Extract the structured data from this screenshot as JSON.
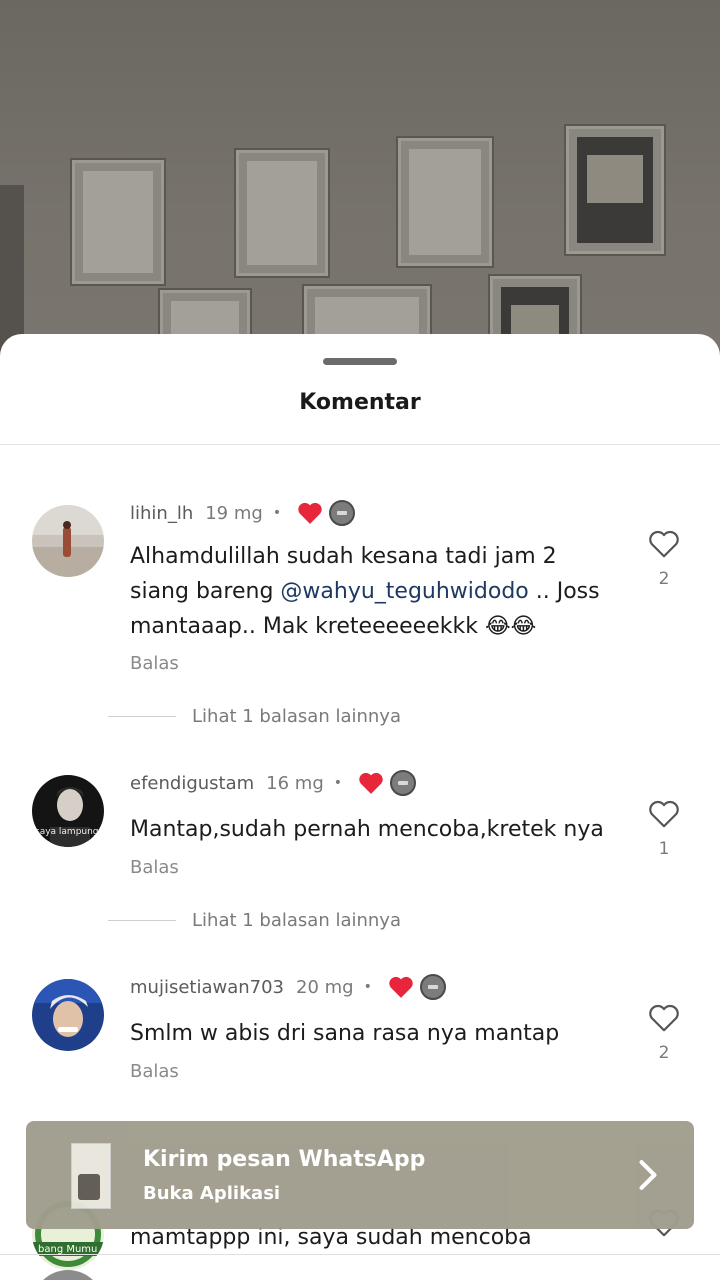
{
  "sheet": {
    "title": "Komentar"
  },
  "comments": [
    {
      "username": "lihin_lh",
      "time": "19 mg",
      "text_before": "Alhamdulillah sudah kesana tadi jam 2 siang bareng ",
      "mention": "@wahyu_teguhwidodo",
      "text_after": " .. Joss mantaaap.. Mak kreteeeeeekkk 😂😂",
      "reply_label": "Balas",
      "likes": "2",
      "more_replies": "Lihat 1 balasan lainnya"
    },
    {
      "username": "efendigustam",
      "time": "16 mg",
      "text": "Mantap,sudah pernah mencoba,kretek nya",
      "avatar_caption": "saya lampung",
      "reply_label": "Balas",
      "likes": "1",
      "more_replies": "Lihat 1 balasan lainnya"
    },
    {
      "username": "mujisetiawan703",
      "time": "20 mg",
      "text": "Smlm w abis dri sana rasa nya mantap",
      "reply_label": "Balas",
      "likes": "2"
    },
    {
      "text": "mamtappp ini, saya sudah mencoba",
      "avatar_caption": "bang Mumu"
    }
  ],
  "whatsapp_banner": {
    "title": "Kirim pesan WhatsApp",
    "subtitle": "Buka Aplikasi"
  },
  "colors": {
    "heart_red": "#e8263b",
    "mention": "#1e3a63",
    "banner": "#a09d8d"
  }
}
